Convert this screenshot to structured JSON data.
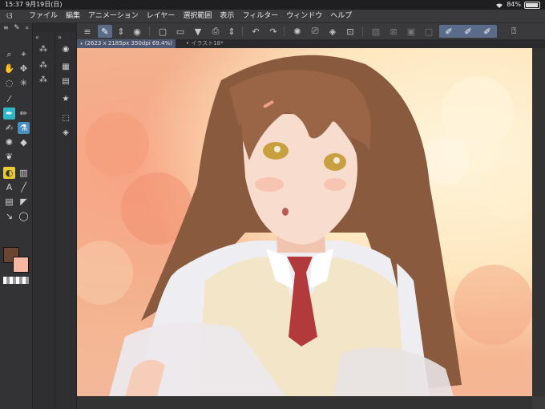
{
  "status_bar": {
    "time": "15:37",
    "date": "9月19日(日)",
    "battery": "84%",
    "battery_level": 0.84
  },
  "menu": {
    "items": [
      "ファイル",
      "編集",
      "アニメーション",
      "レイヤー",
      "選択範囲",
      "表示",
      "フィルター",
      "ウィンドウ",
      "ヘルプ"
    ]
  },
  "tabs": [
    {
      "label": "⁎ (2623 x 2185px 350dpi 69.4%)",
      "active": true
    },
    {
      "label": "• イラスト18*",
      "active": false
    }
  ],
  "colors": {
    "main_color": "#6a4532",
    "sub_color": "#f7b7a0",
    "accent": "#4a8fbf"
  },
  "canvas": {
    "content": "anime-style illustration of a long brown-haired girl in a white shirt, cream vest and red tie, holding an open book, looking up, on a warm orange bokeh background"
  }
}
